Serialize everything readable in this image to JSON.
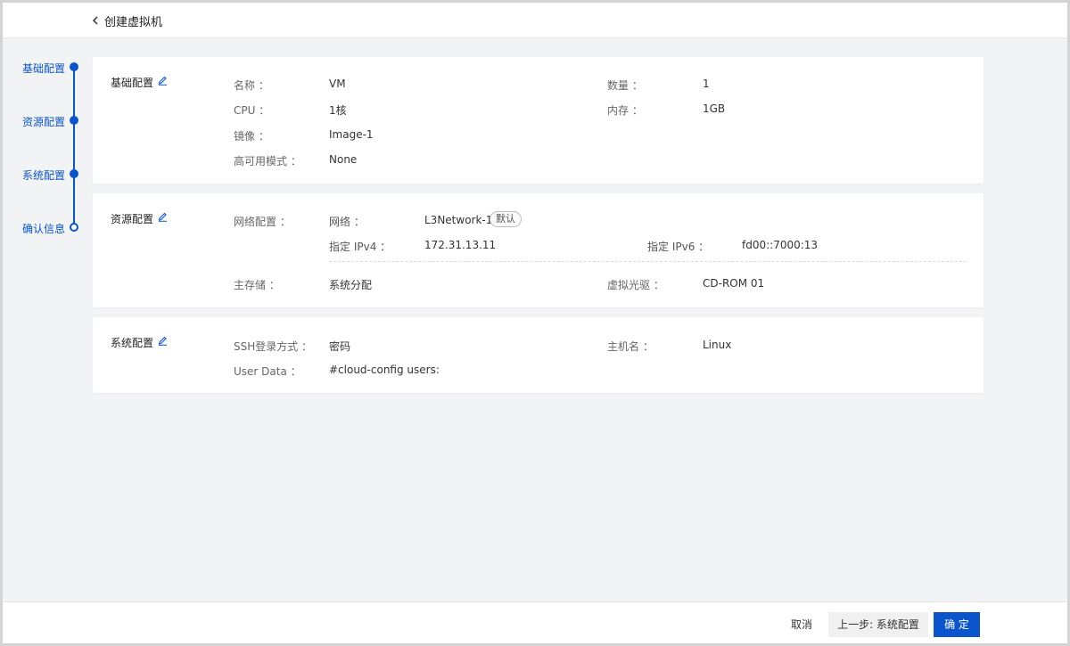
{
  "header": {
    "title": "创建虚拟机"
  },
  "stepper": {
    "steps": [
      {
        "label": "基础配置"
      },
      {
        "label": "资源配置"
      },
      {
        "label": "系统配置"
      },
      {
        "label": "确认信息"
      }
    ]
  },
  "basic": {
    "title": "基础配置",
    "name_label": "名称 ：",
    "name_value": "VM",
    "count_label": "数量 ：",
    "count_value": "1",
    "cpu_label": "CPU ：",
    "cpu_value": "1核",
    "mem_label": "内存 ：",
    "mem_value": "1GB",
    "image_label": "镜像 ：",
    "image_value": "Image-1",
    "ha_label": "高可用模式 ：",
    "ha_value": "None"
  },
  "resource": {
    "title": "资源配置",
    "net_config_label": "网络配置 ：",
    "network_label": "网络 ：",
    "network_value": "L3Network-1",
    "network_badge": "默认",
    "ipv4_label": "指定 IPv4 ：",
    "ipv4_value": "172.31.13.11",
    "ipv6_label": "指定 IPv6 ：",
    "ipv6_value": "fd00::7000:13",
    "storage_label": "主存储 ：",
    "storage_value": "系统分配",
    "cdrom_label": "虚拟光驱 ：",
    "cdrom_value": "CD-ROM 01"
  },
  "system": {
    "title": "系统配置",
    "ssh_label": "SSH登录方式 ：",
    "ssh_value": "密码",
    "host_label": "主机名 ：",
    "host_value": "Linux",
    "userdata_label": "User Data ：",
    "userdata_value": "#cloud-config users:"
  },
  "footer": {
    "cancel_label": "取消",
    "prev_label": "上一步: 系统配置",
    "confirm_label": "确 定"
  },
  "colors": {
    "accent": "#0a55cc",
    "background": "#f2f3f5"
  }
}
